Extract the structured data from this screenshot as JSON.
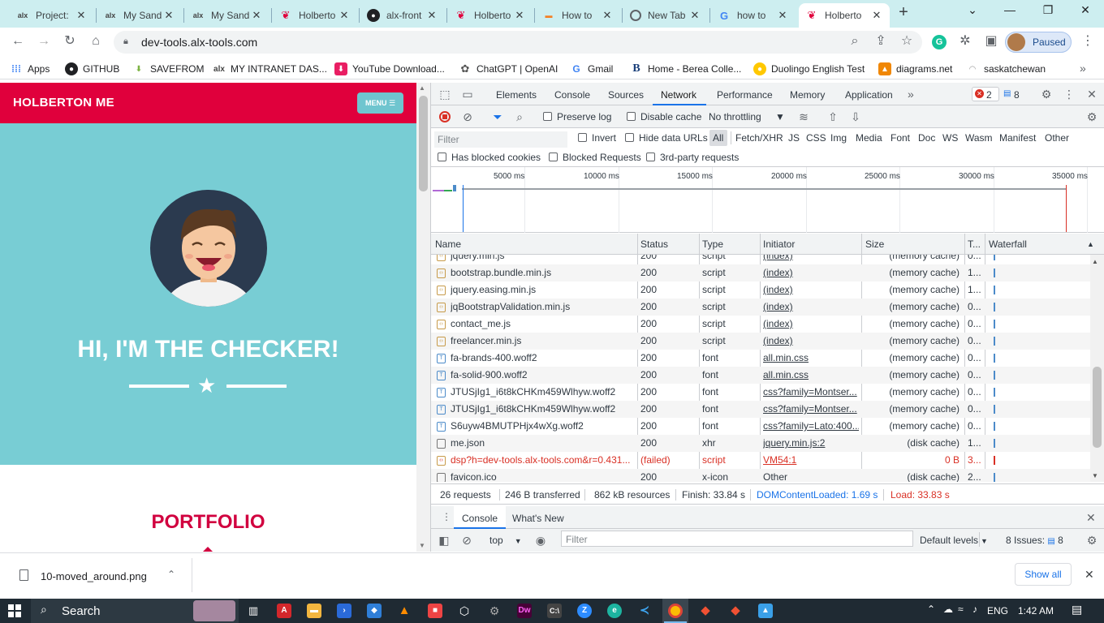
{
  "browser": {
    "tabs": [
      {
        "label": "Project: ",
        "icon": "alx-icon"
      },
      {
        "label": "My Sandb",
        "icon": "alx-icon"
      },
      {
        "label": "My Sandb",
        "icon": "alx-icon"
      },
      {
        "label": "Holberto",
        "icon": "holberton-icon"
      },
      {
        "label": "alx-front",
        "icon": "github-icon"
      },
      {
        "label": "Holberto",
        "icon": "holberton-icon"
      },
      {
        "label": "How to",
        "icon": "stackoverflow-icon"
      },
      {
        "label": "New Tab",
        "icon": "chrome-icon"
      },
      {
        "label": "how to ",
        "icon": "google-icon"
      },
      {
        "label": "Holberto",
        "icon": "holberton-icon"
      }
    ],
    "url": "dev-tools.alx-tools.com",
    "profile_status": "Paused",
    "bookmarks": [
      {
        "label": "Apps"
      },
      {
        "label": "GITHUB"
      },
      {
        "label": "SAVEFROM"
      },
      {
        "label": "MY INTRANET DAS..."
      },
      {
        "label": "YouTube Download..."
      },
      {
        "label": "ChatGPT | OpenAI"
      },
      {
        "label": "Gmail"
      },
      {
        "label": "Home - Berea Colle..."
      },
      {
        "label": "Duolingo English Test"
      },
      {
        "label": "diagrams.net"
      },
      {
        "label": "saskatchewan"
      }
    ]
  },
  "page": {
    "brand": "HOLBERTON ME",
    "menu_label": "MENU",
    "hero_title": "HI, I'M THE CHECKER!",
    "section_title": "PORTFOLIO"
  },
  "devtools": {
    "panels": [
      "Elements",
      "Console",
      "Sources",
      "Network",
      "Performance",
      "Memory",
      "Application"
    ],
    "active_panel": "Network",
    "error_count": "2",
    "message_count": "8",
    "preserve_log": "Preserve log",
    "disable_cache": "Disable cache",
    "throttling": "No throttling",
    "filter_placeholder": "Filter",
    "invert": "Invert",
    "hide_data_urls": "Hide data URLs",
    "type_filters": [
      "All",
      "Fetch/XHR",
      "JS",
      "CSS",
      "Img",
      "Media",
      "Font",
      "Doc",
      "WS",
      "Wasm",
      "Manifest",
      "Other"
    ],
    "has_blocked_cookies": "Has blocked cookies",
    "blocked_requests": "Blocked Requests",
    "third_party": "3rd-party requests",
    "timeline_ticks": [
      "5000 ms",
      "10000 ms",
      "15000 ms",
      "20000 ms",
      "25000 ms",
      "30000 ms",
      "35000 ms"
    ],
    "columns": [
      "Name",
      "Status",
      "Type",
      "Initiator",
      "Size",
      "T...",
      "Waterfall"
    ],
    "requests": [
      {
        "name": "jquery.min.js",
        "status": "200",
        "type": "script",
        "initiator": "(index)",
        "size": "(memory cache)",
        "time": "0...",
        "kind": "js"
      },
      {
        "name": "bootstrap.bundle.min.js",
        "status": "200",
        "type": "script",
        "initiator": "(index)",
        "size": "(memory cache)",
        "time": "1...",
        "kind": "js"
      },
      {
        "name": "jquery.easing.min.js",
        "status": "200",
        "type": "script",
        "initiator": "(index)",
        "size": "(memory cache)",
        "time": "1...",
        "kind": "js"
      },
      {
        "name": "jqBootstrapValidation.min.js",
        "status": "200",
        "type": "script",
        "initiator": "(index)",
        "size": "(memory cache)",
        "time": "0...",
        "kind": "js"
      },
      {
        "name": "contact_me.js",
        "status": "200",
        "type": "script",
        "initiator": "(index)",
        "size": "(memory cache)",
        "time": "0...",
        "kind": "js"
      },
      {
        "name": "freelancer.min.js",
        "status": "200",
        "type": "script",
        "initiator": "(index)",
        "size": "(memory cache)",
        "time": "0...",
        "kind": "js"
      },
      {
        "name": "fa-brands-400.woff2",
        "status": "200",
        "type": "font",
        "initiator": "all.min.css",
        "size": "(memory cache)",
        "time": "0...",
        "kind": "font"
      },
      {
        "name": "fa-solid-900.woff2",
        "status": "200",
        "type": "font",
        "initiator": "all.min.css",
        "size": "(memory cache)",
        "time": "0...",
        "kind": "font"
      },
      {
        "name": "JTUSjIg1_i6t8kCHKm459Wlhyw.woff2",
        "status": "200",
        "type": "font",
        "initiator": "css?family=Montser...",
        "size": "(memory cache)",
        "time": "0...",
        "kind": "font"
      },
      {
        "name": "JTUSjIg1_i6t8kCHKm459Wlhyw.woff2",
        "status": "200",
        "type": "font",
        "initiator": "css?family=Montser...",
        "size": "(memory cache)",
        "time": "0...",
        "kind": "font"
      },
      {
        "name": "S6uyw4BMUTPHjx4wXg.woff2",
        "status": "200",
        "type": "font",
        "initiator": "css?family=Lato:400...",
        "size": "(memory cache)",
        "time": "0...",
        "kind": "font"
      },
      {
        "name": "me.json",
        "status": "200",
        "type": "xhr",
        "initiator": "jquery.min.js:2",
        "size": "(disk cache)",
        "time": "1...",
        "kind": "plain"
      },
      {
        "name": "dsp?h=dev-tools.alx-tools.com&r=0.431...",
        "status": "(failed)",
        "type": "script",
        "initiator": "VM54:1",
        "size": "0 B",
        "time": "3...",
        "kind": "js",
        "failed": true
      },
      {
        "name": "favicon.ico",
        "status": "200",
        "type": "x-icon",
        "initiator": "Other",
        "size": "(disk cache)",
        "time": "2...",
        "kind": "plain"
      }
    ],
    "summary": {
      "requests": "26 requests",
      "transferred": "246 B transferred",
      "resources": "862 kB resources",
      "finish": "Finish: 33.84 s",
      "dcl": "DOMContentLoaded: 1.69 s",
      "load": "Load: 33.83 s"
    },
    "drawer": {
      "tabs": [
        "Console",
        "What's New"
      ],
      "context": "top",
      "filter_placeholder": "Filter",
      "levels": "Default levels",
      "issues": "8 Issues:",
      "issues_count": "8"
    }
  },
  "downloads": {
    "file": "10-moved_around.png",
    "show_all": "Show all"
  },
  "taskbar": {
    "search": "Search",
    "language": "ENG",
    "time": "1:42 AM"
  }
}
